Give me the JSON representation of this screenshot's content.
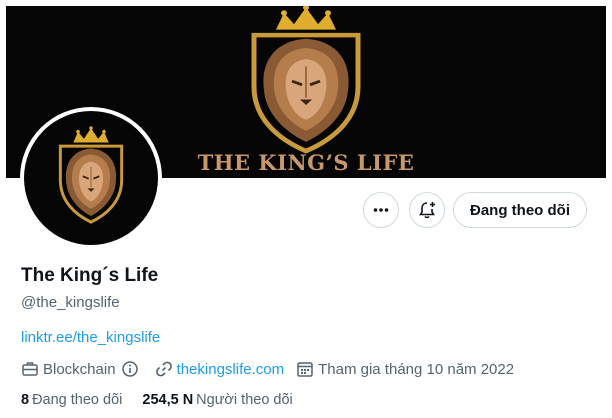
{
  "banner": {
    "title": "THE KING’S LIFE",
    "logo_icon": "lion-crown-logo",
    "bg": "#050505",
    "accent": "#c9986a"
  },
  "avatar": {
    "icon": "lion-crown-logo"
  },
  "actions": {
    "more_icon": "more-icon",
    "notify_icon": "bell-plus-icon",
    "follow_label": "Đang theo dõi"
  },
  "profile": {
    "name": "The King´s Life",
    "handle": "@the_kingslife",
    "bio_link": "linktr.ee/the_kingslife",
    "category": "Blockchain",
    "website": "thekingslife.com",
    "joined": "Tham gia tháng 10 năm 2022"
  },
  "stats": {
    "following_count": "8",
    "following_label": "Đang theo dõi",
    "followers_count": "254,5 N",
    "followers_label": "Người theo dõi"
  },
  "colors": {
    "link": "#1d9bf0",
    "muted": "#536471",
    "text": "#0f1419",
    "border": "#cfd9de"
  }
}
